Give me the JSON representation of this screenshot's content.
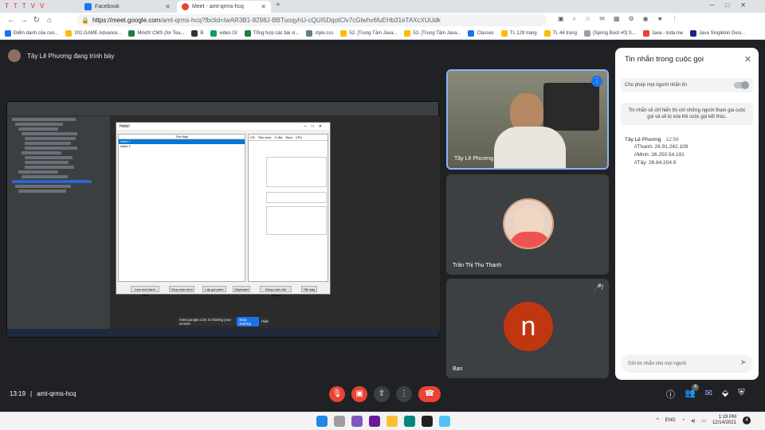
{
  "browser": {
    "tabs": [
      {
        "label": "Facebook",
        "color": "#1877f2"
      },
      {
        "label": "Meet - amt-qrms-hcq",
        "color": "#ea4335"
      }
    ],
    "url_host": "https://meet.google.com",
    "url_path": "/amt-qrms-hcq?fbclid=IwAR3B1-8298J-BBTuoqyhU-cQUI5DqotClv7cGlwhv6fuEHb31eTAXcXUUdk",
    "bookmarks": [
      "Điểm danh của cxo...",
      "202.GAME Advance...",
      "MindX CMS (for Tea...",
      "B",
      "video GI",
      "Tổng hợp các bài vi...",
      "style.css",
      "52. [Trung Tâm Java...",
      "53. [Trung Tâm Java...",
      "Classes",
      "TL 129 trang",
      "TL 44 trang",
      "[Spring Boot #0] S...",
      "Java - loda.me",
      "Java Singleton Desi..."
    ]
  },
  "meet": {
    "presenter_text": "Tây Lê Phương đang trình bày",
    "participants": [
      {
        "name": "Tây Lê Phương"
      },
      {
        "name": "Trần Thị Thu Thanh"
      },
      {
        "name": "Bạn",
        "initial": "n",
        "avatar_color": "#c0360f"
      }
    ],
    "clock": "13:19",
    "meeting_code": "amt-qrms-hcq",
    "people_count": "4"
  },
  "shared_screen": {
    "app_title": "Hello!",
    "list_header": "Tên Máy",
    "list_items": [
      "client 1",
      "client 2"
    ],
    "tabs": [
      "OS",
      "Tiến trình",
      "Ổ đĩa",
      "Ram",
      "CPU"
    ],
    "buttons": [
      "Làm mới danh sách",
      "Chụp màn hình",
      "Lấy gói phím",
      "Clipboard",
      "Đóng cuột của phòng",
      "Tắt máy"
    ],
    "share_notice": "meet.google.com is sharing your screen.",
    "stop_label": "Stop sharing",
    "hide_label": "Hide"
  },
  "chat": {
    "title": "Tin nhắn trong cuộc gọi",
    "allow_label": "Cho phép mọi người nhắn tin",
    "note": "Tin nhắn sẽ chỉ hiển thị với những người tham gia cuộc gọi và sẽ bị xóa khi cuộc gọi kết thúc.",
    "message": {
      "sender": "Tây Lê Phương",
      "time": "12:56",
      "lines": [
        "//Thanh: 26.91.242.109",
        "//Minh: 26.250.54.191",
        "//Tây: 26.84.204.9"
      ]
    },
    "input_placeholder": "Gửi tin nhắn cho mọi người"
  },
  "taskbar": {
    "lang": "ENG",
    "time": "1:19 PM",
    "date": "12/14/2021",
    "notifications": "4"
  }
}
